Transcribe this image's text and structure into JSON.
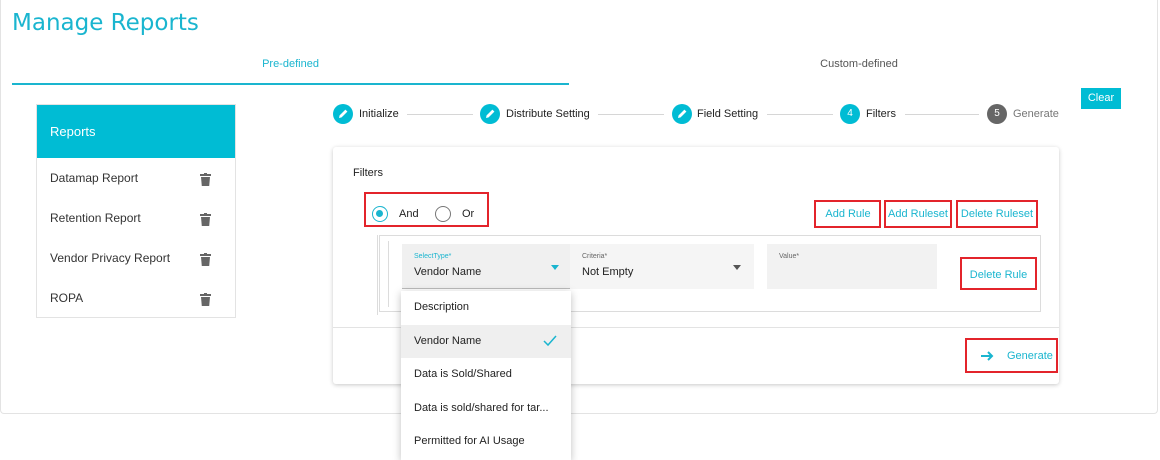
{
  "page": {
    "title": "Manage Reports"
  },
  "tabs": {
    "predefined": "Pre-defined",
    "customdefined": "Custom-defined"
  },
  "actions": {
    "clear": "Clear"
  },
  "sidebar": {
    "header": "Reports",
    "items": [
      {
        "label": "Datamap Report"
      },
      {
        "label": "Retention Report"
      },
      {
        "label": "Vendor Privacy Report"
      },
      {
        "label": "ROPA"
      }
    ],
    "item_icon": "trash-icon"
  },
  "stepper": {
    "steps": [
      {
        "label": "Initialize",
        "icon": "pencil-icon",
        "state": "done"
      },
      {
        "label": "Distribute Setting",
        "icon": "pencil-icon",
        "state": "done"
      },
      {
        "label": "Field Setting",
        "icon": "pencil-icon",
        "state": "done"
      },
      {
        "number": "4",
        "label": "Filters",
        "state": "active"
      },
      {
        "number": "5",
        "label": "Generate",
        "state": "pending"
      }
    ]
  },
  "filters": {
    "title": "Filters",
    "condition": {
      "and": "And",
      "or": "Or",
      "selected": "And"
    },
    "buttons": {
      "add_rule": "Add Rule",
      "add_ruleset": "Add Ruleset",
      "delete_ruleset": "Delete Ruleset",
      "delete_rule": "Delete Rule"
    },
    "rule": {
      "select_type": {
        "label": "SelectType*",
        "value": "Vendor Name"
      },
      "criteria": {
        "label": "Criteria*",
        "value": "Not Empty"
      },
      "value": {
        "label": "Value*",
        "value": ""
      }
    },
    "generate": "Generate",
    "dropdown": {
      "options": [
        "Description",
        "Vendor Name",
        "Data is Sold/Shared",
        "Data is sold/shared for tar...",
        "Permitted for AI Usage"
      ],
      "selected": "Vendor Name"
    }
  },
  "colors": {
    "accent": "#00bcd4",
    "highlight": "#e3242b",
    "step_pending": "#666666"
  }
}
